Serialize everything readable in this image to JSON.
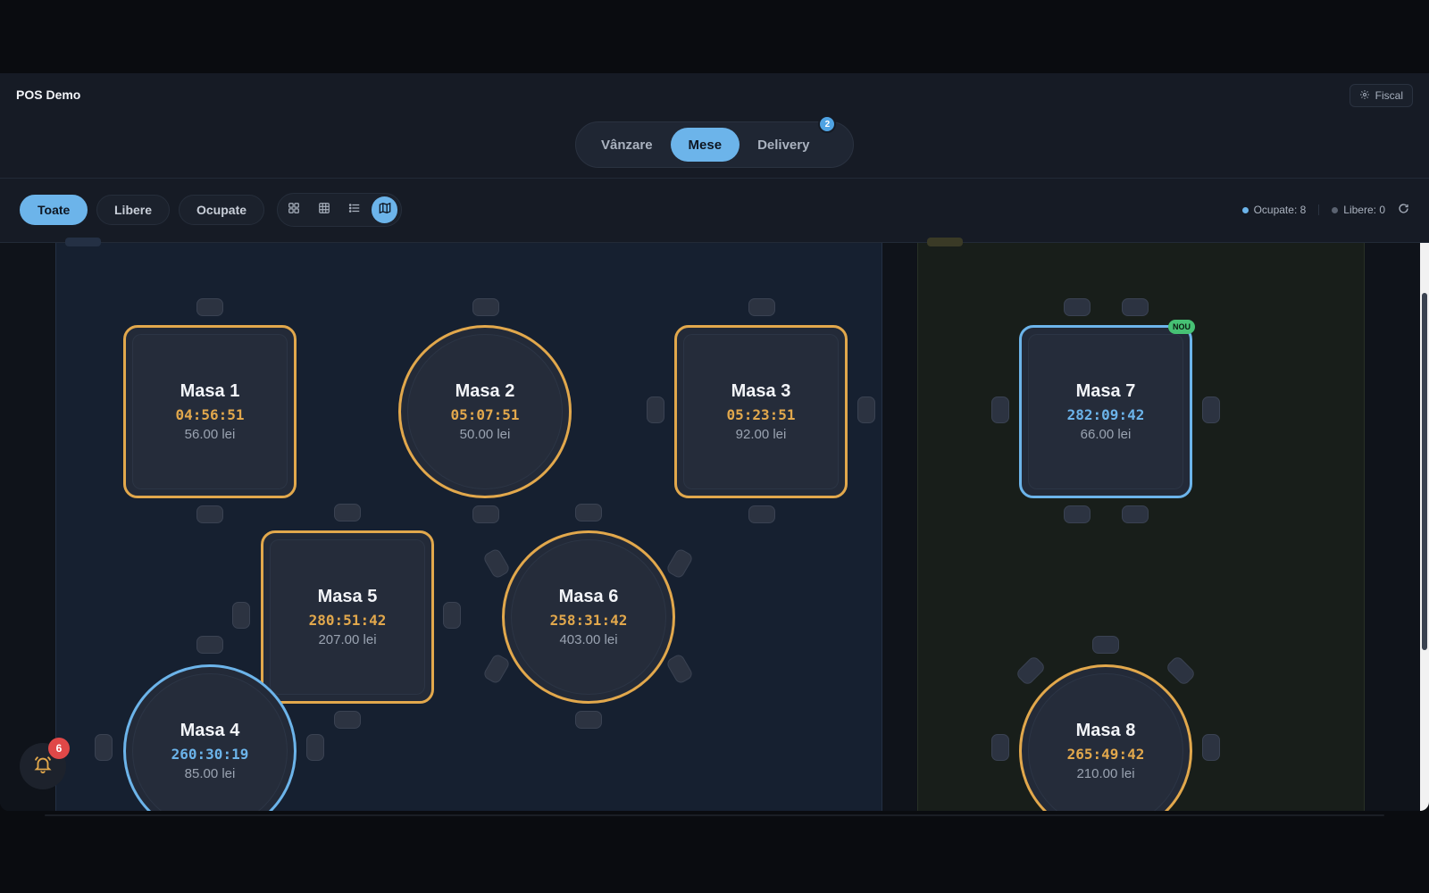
{
  "app": {
    "title": "POS Demo"
  },
  "header": {
    "fiscal_label": "Fiscal",
    "fiscal_icon": "gear-icon"
  },
  "modes": [
    {
      "label": "Vânzare",
      "active": false
    },
    {
      "label": "Mese",
      "active": true
    },
    {
      "label": "Delivery",
      "active": false,
      "badge": "2"
    }
  ],
  "filters": [
    {
      "label": "Toate",
      "active": true
    },
    {
      "label": "Libere",
      "active": false
    },
    {
      "label": "Ocupate",
      "active": false
    }
  ],
  "views": [
    {
      "icon": "grid-large-icon",
      "active": false
    },
    {
      "icon": "grid-small-icon",
      "active": false
    },
    {
      "icon": "list-icon",
      "active": false
    },
    {
      "icon": "map-icon",
      "active": true
    }
  ],
  "stats": {
    "occupied_label": "Ocupate: 8",
    "free_label": "Libere: 0",
    "occupied_color": "#6cb4ea",
    "free_color": "#5a6270"
  },
  "tables": [
    {
      "name": "Masa 1",
      "time": "04:56:51",
      "amount": "56.00 lei",
      "shape": "square",
      "status_color": "#e2a84c"
    },
    {
      "name": "Masa 2",
      "time": "05:07:51",
      "amount": "50.00 lei",
      "shape": "round",
      "status_color": "#e2a84c"
    },
    {
      "name": "Masa 3",
      "time": "05:23:51",
      "amount": "92.00 lei",
      "shape": "square",
      "status_color": "#e2a84c"
    },
    {
      "name": "Masa 4",
      "time": "260:30:19",
      "amount": "85.00 lei",
      "shape": "round",
      "status_color": "#6cb4ea"
    },
    {
      "name": "Masa 5",
      "time": "280:51:42",
      "amount": "207.00 lei",
      "shape": "square",
      "status_color": "#e2a84c"
    },
    {
      "name": "Masa 6",
      "time": "258:31:42",
      "amount": "403.00 lei",
      "shape": "round",
      "status_color": "#e2a84c"
    },
    {
      "name": "Masa 7",
      "time": "282:09:42",
      "amount": "66.00 lei",
      "shape": "square",
      "status_color": "#6cb4ea",
      "tag": "NOU"
    },
    {
      "name": "Masa 8",
      "time": "265:49:42",
      "amount": "210.00 lei",
      "shape": "round",
      "status_color": "#e2a84c"
    }
  ],
  "notifications": {
    "count": "6",
    "icon": "bell-icon"
  }
}
